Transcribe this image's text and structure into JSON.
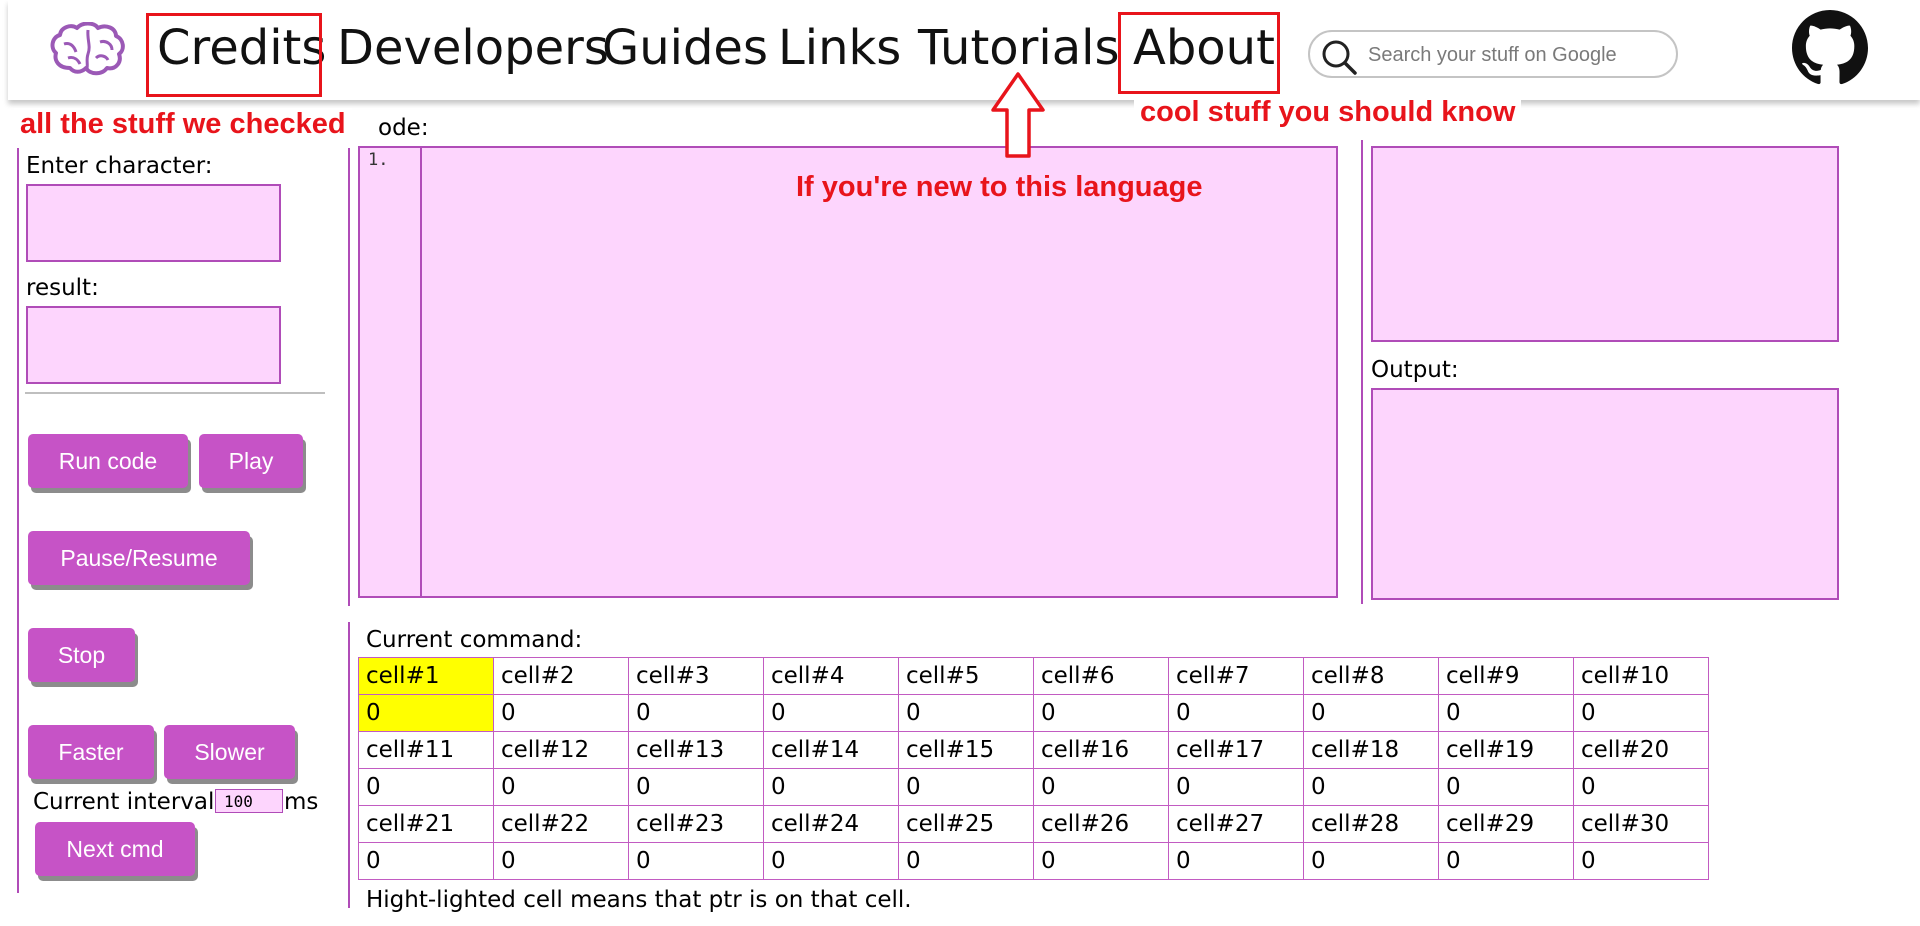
{
  "nav": {
    "links": [
      "Credits",
      "Developers",
      "Guides",
      "Links",
      "Tutorials",
      "About"
    ],
    "search_placeholder": "Search your stuff on Google"
  },
  "icons": {
    "logo": "brain-icon",
    "search": "search-icon",
    "github": "github-icon"
  },
  "annotations": {
    "credits": "all the stuff we checked",
    "about": "cool stuff you should know",
    "tutorials": "If you're new to this language"
  },
  "sidebar": {
    "enter_label": "Enter character:",
    "result_label": "result:",
    "buttons": {
      "run": "Run code",
      "play": "Play",
      "pause": "Pause/Resume",
      "stop": "Stop",
      "faster": "Faster",
      "slower": "Slower",
      "next": "Next cmd"
    },
    "interval_label": "Current interval:",
    "interval_value": "100",
    "interval_unit": "ms"
  },
  "editor": {
    "label": "Code:",
    "label_visible": "ode:",
    "line_number": "1."
  },
  "output": {
    "label": "Output:"
  },
  "memory": {
    "current_command_label": "Current command:",
    "rows": [
      {
        "cells": [
          "cell#1",
          "cell#2",
          "cell#3",
          "cell#4",
          "cell#5",
          "cell#6",
          "cell#7",
          "cell#8",
          "cell#9",
          "cell#10"
        ],
        "values": [
          "0",
          "0",
          "0",
          "0",
          "0",
          "0",
          "0",
          "0",
          "0",
          "0"
        ]
      },
      {
        "cells": [
          "cell#11",
          "cell#12",
          "cell#13",
          "cell#14",
          "cell#15",
          "cell#16",
          "cell#17",
          "cell#18",
          "cell#19",
          "cell#20"
        ],
        "values": [
          "0",
          "0",
          "0",
          "0",
          "0",
          "0",
          "0",
          "0",
          "0",
          "0"
        ]
      },
      {
        "cells": [
          "cell#21",
          "cell#22",
          "cell#23",
          "cell#24",
          "cell#25",
          "cell#26",
          "cell#27",
          "cell#28",
          "cell#29",
          "cell#30"
        ],
        "values": [
          "0",
          "0",
          "0",
          "0",
          "0",
          "0",
          "0",
          "0",
          "0",
          "0"
        ]
      }
    ],
    "highlighted_cell": "cell#1",
    "footnote": "Hight-lighted cell means that ptr is on that cell."
  },
  "colors": {
    "accent": "#c653c6",
    "panel": "#fdd5fd",
    "border": "#b04cb8",
    "annotation": "#e8141b",
    "highlight": "#ffff00"
  }
}
